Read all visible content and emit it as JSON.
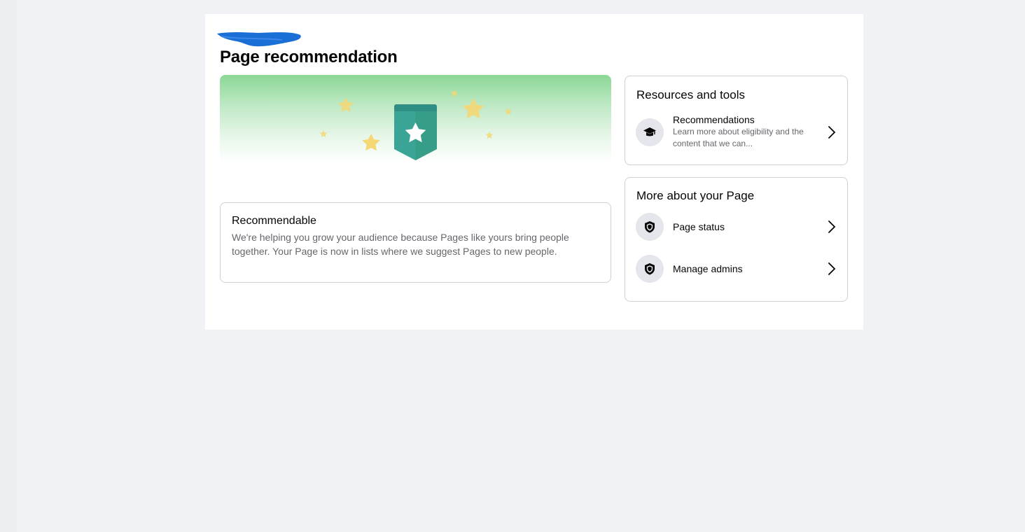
{
  "page": {
    "title": "Page recommendation"
  },
  "banner": {
    "icon": "star-ribbon-badge-illustration"
  },
  "status_card": {
    "heading": "Recommendable",
    "body": "We're helping you grow your audience because Pages like yours bring people together. Your Page is now in lists where we suggest Pages to new people."
  },
  "resources": {
    "title": "Resources and tools",
    "items": [
      {
        "label": "Recommendations",
        "description": "Learn more about eligibility and the content that we can...",
        "icon": "graduation-cap-icon"
      }
    ]
  },
  "more_about": {
    "title": "More about your Page",
    "items": [
      {
        "label": "Page status",
        "icon": "shield-icon"
      },
      {
        "label": "Manage admins",
        "icon": "shield-icon"
      }
    ]
  },
  "colors": {
    "background": "#f0f2f5",
    "panel": "#ffffff",
    "banner_green": "#8bd795",
    "badge_teal": "#3aa596",
    "star_gold": "#f5d774",
    "secondary_text": "#65676b",
    "redaction_blue": "#1a6fd6"
  }
}
